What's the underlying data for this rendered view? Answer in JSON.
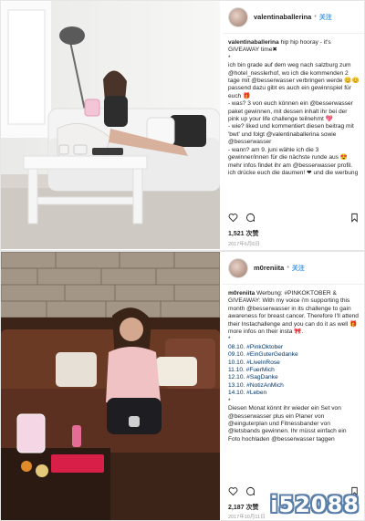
{
  "post1": {
    "username": "valentinaballerina",
    "follow_label": "关注",
    "caption_user": "valentinaballerina",
    "caption_lines": [
      " hip hip hooray - it's GIVEAWAY time✖",
      "*",
      "ich bin grade auf dem weg nach salzburg zum @hotel_nesslerhof, wo ich die kommenden 2 tage mit @besserwasser verbringen werde 😊😊 passend dazu gibt es auch ein gewinnspiel für euch 🎁",
      "- was? 3 von euch können ein @besserwasser paket gewinnen, mit dessen inhalt ihr bei der pink up your life challenge teilnehmt 💖",
      "- wie? liked und kommentiert diesen beitrag mit 'bwt' und folgt @valentinaballerina sowie @besserwasser",
      "- wann? am 9. juni wähle ich die 3 gewinner/innen für die nächste runde aus 😍",
      "mehr infos findet ihr am @besserwasser profil. ich drücke euch die daumen! ❤ und die werbung"
    ],
    "likes": "1,521 次赞",
    "date": "2017年6月6日"
  },
  "post2": {
    "username": "m0reniita",
    "follow_label": "关注",
    "caption_user": "m0reniita",
    "caption_lines": [
      " Werbung: #PINKOKTOBER & GIVEAWAY: With my voice i'm supporting this month @besserwasser in its challenge to gain awareness for breast cancer. Therefore I'll attend their Instachallenge and you can do it as well 🎁 more infos on their insta 🎀.",
      "*",
      "08.10. #PinkOktober",
      "09.10. #EinGuterGedanke",
      "10.10. #LiveInRose",
      "11.10. #FuerMich",
      "12.10. #SagDanke",
      "13.10. #NotizAnMich",
      "14.10. #Leben",
      "*",
      "Diesen Monat könnt ihr wieder ein Set von @besserwasser plus ein Planer von @einguterplan und Fitnessbander von @letsbands gewinnen. Ihr müsst einfach ein Foto hochladen @besserwasser taggen"
    ],
    "likes": "2,187 次赞",
    "date": "2017年10月11日"
  },
  "watermark": "i52088"
}
